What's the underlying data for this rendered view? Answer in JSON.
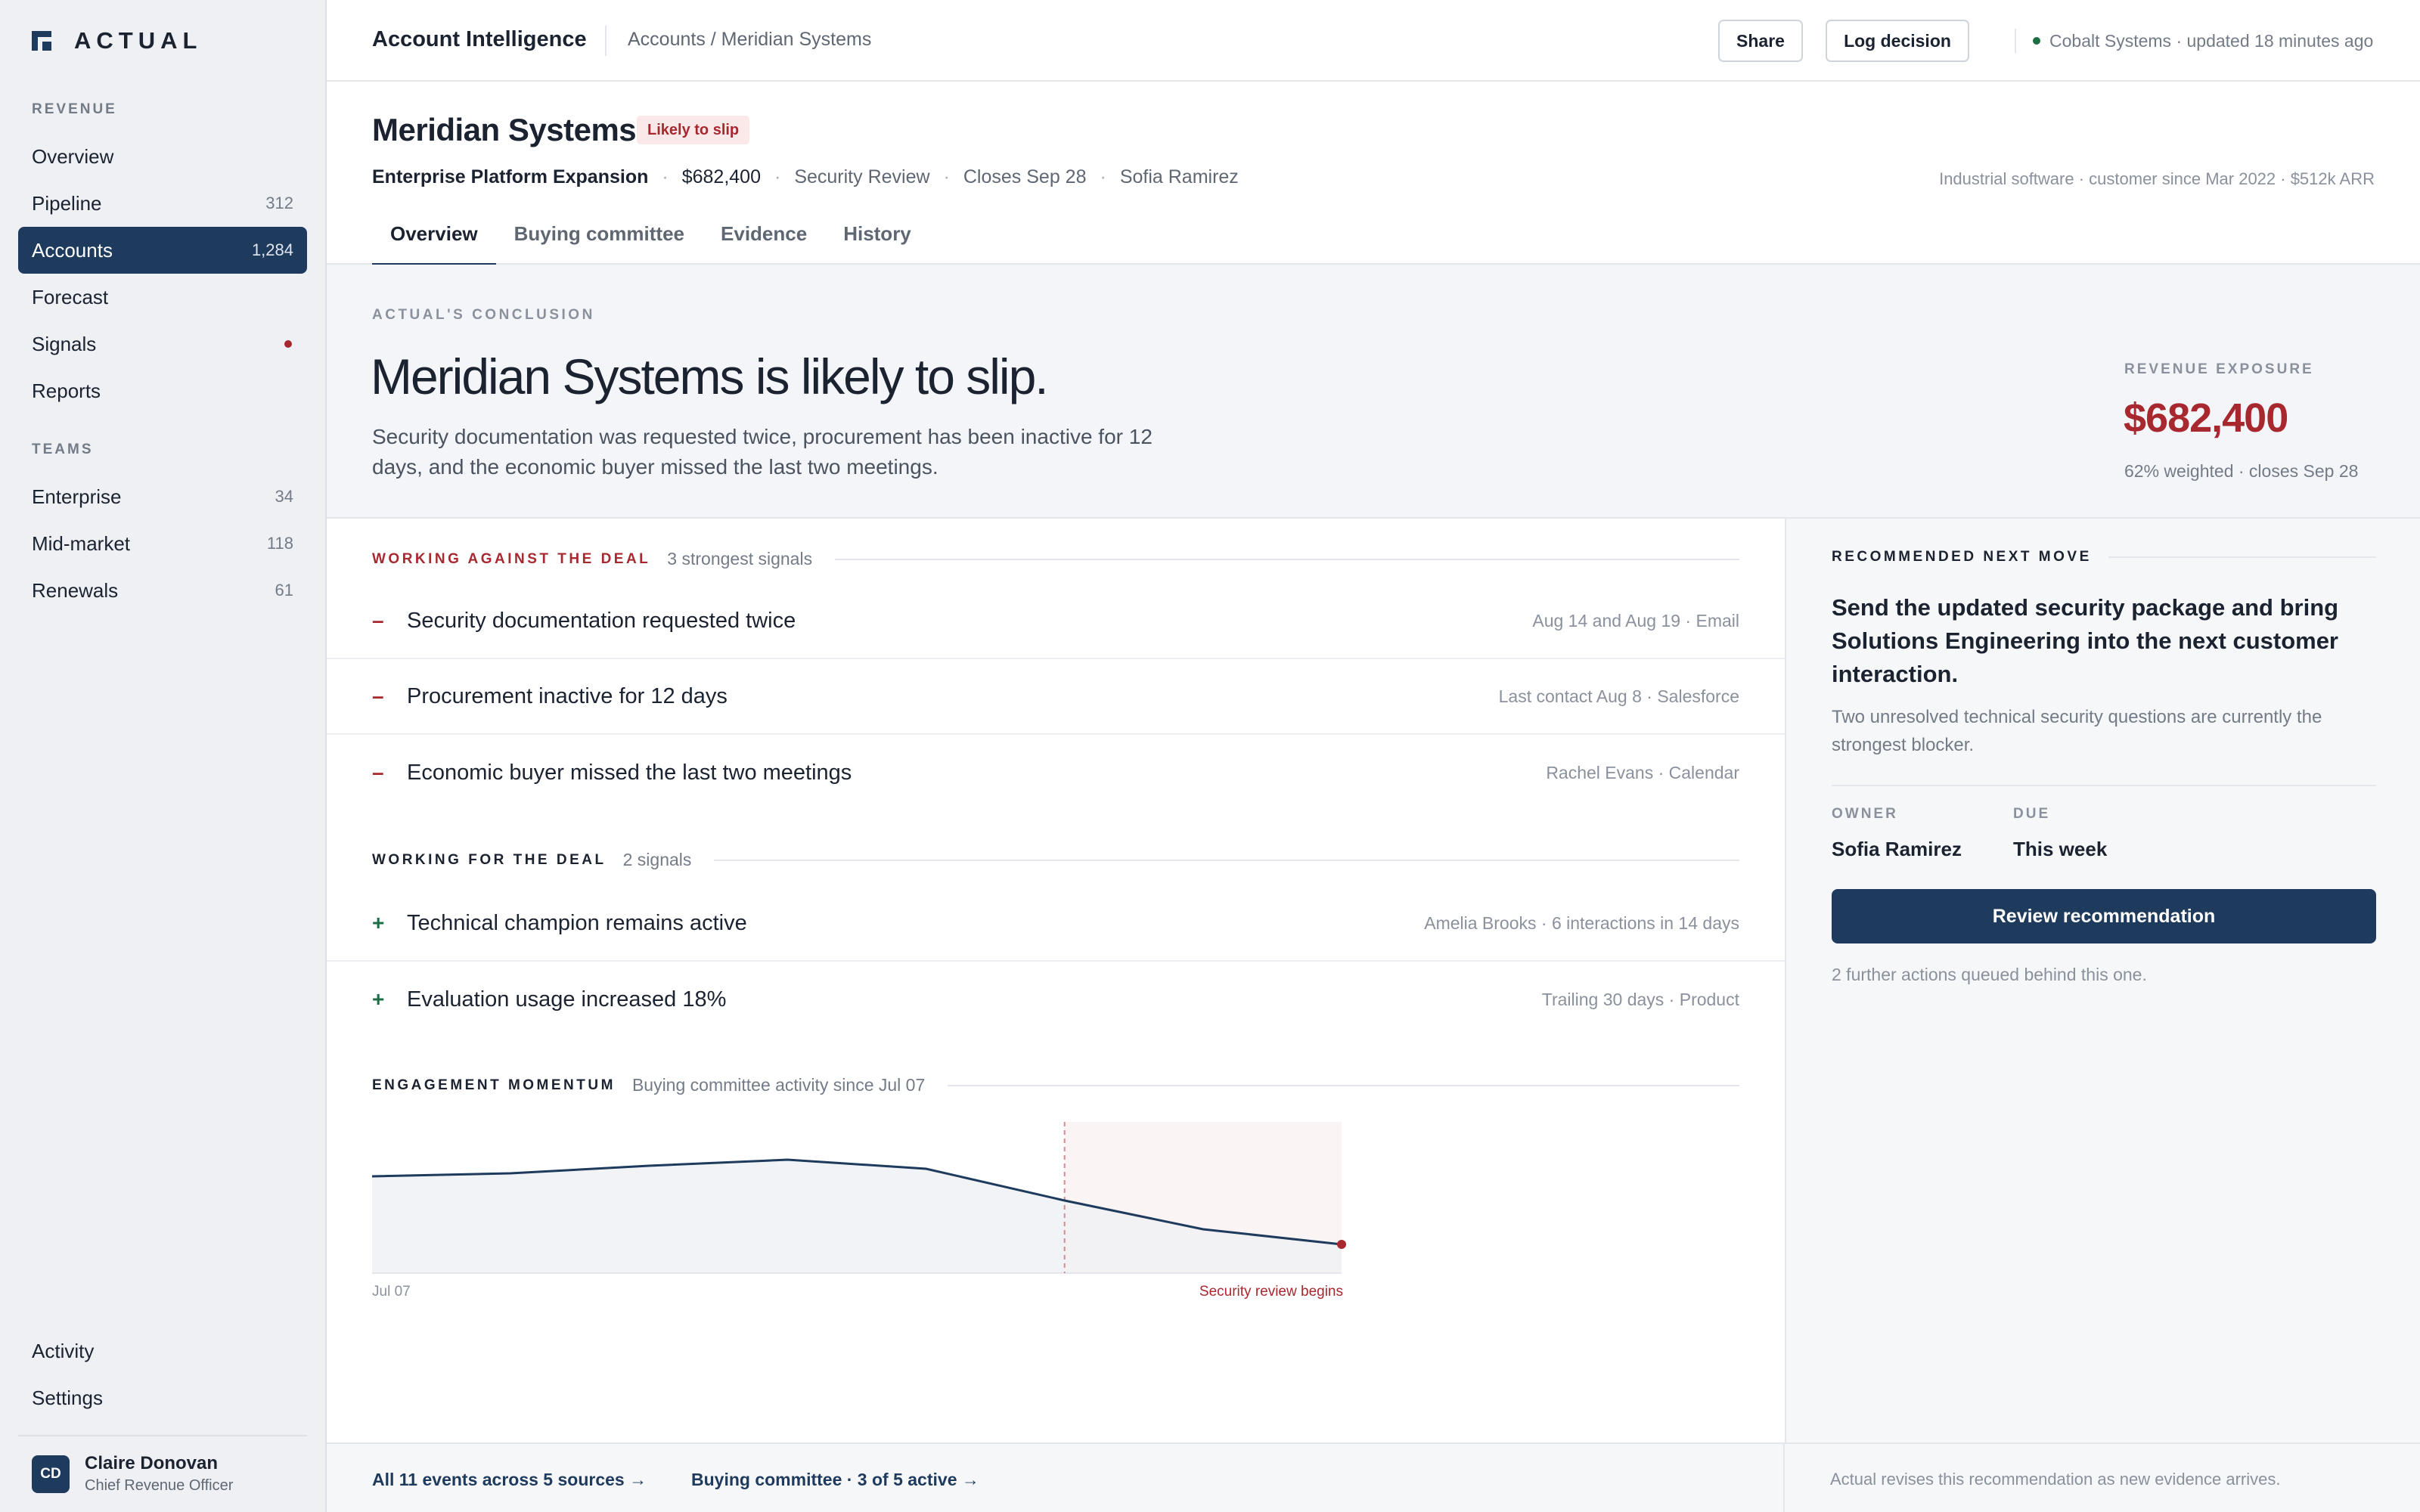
{
  "brand": {
    "name": "ACTUAL"
  },
  "sidebar": {
    "revenue_label": "REVENUE",
    "revenue_items": [
      {
        "label": "Overview",
        "count": ""
      },
      {
        "label": "Pipeline",
        "count": "312"
      },
      {
        "label": "Accounts",
        "count": "1,284",
        "active": true
      },
      {
        "label": "Forecast",
        "count": ""
      },
      {
        "label": "Signals",
        "count": "",
        "alert": true
      },
      {
        "label": "Reports",
        "count": ""
      }
    ],
    "teams_label": "TEAMS",
    "team_items": [
      {
        "label": "Enterprise",
        "count": "34"
      },
      {
        "label": "Mid-market",
        "count": "118"
      },
      {
        "label": "Renewals",
        "count": "61"
      }
    ],
    "bottom_items": [
      {
        "label": "Activity"
      },
      {
        "label": "Settings"
      }
    ],
    "user": {
      "initials": "CD",
      "name": "Claire Donovan",
      "role": "Chief Revenue Officer"
    }
  },
  "topbar": {
    "title": "Account Intelligence",
    "breadcrumb": "Accounts / Meridian Systems",
    "share_label": "Share",
    "log_decision_label": "Log decision",
    "status": "Cobalt Systems · updated 18 minutes ago"
  },
  "account": {
    "name": "Meridian Systems",
    "badge": "Likely to slip",
    "deal_name": "Enterprise Platform Expansion",
    "amount": "$682,400",
    "stage": "Security Review",
    "close": "Closes Sep 28",
    "owner": "Sofia Ramirez",
    "company_info": "Industrial software · customer since Mar 2022 · $512k ARR",
    "tabs": [
      "Overview",
      "Buying committee",
      "Evidence",
      "History"
    ]
  },
  "conclusion": {
    "eyebrow": "ACTUAL'S CONCLUSION",
    "headline": "Meridian Systems is likely to slip.",
    "text": "Security documentation was requested twice, procurement has been inactive for 12 days, and the economic buyer missed the last two meetings.",
    "exposure_label": "REVENUE EXPOSURE",
    "exposure_value": "$682,400",
    "exposure_meta": "62% weighted · closes Sep 28"
  },
  "against": {
    "title": "WORKING AGAINST THE DEAL",
    "subtitle": "3 strongest signals",
    "items": [
      {
        "mark": "–",
        "text": "Security documentation requested twice",
        "source": "Aug 14 and Aug 19 · Email"
      },
      {
        "mark": "–",
        "text": "Procurement inactive for 12 days",
        "source": "Last contact Aug 8 · Salesforce"
      },
      {
        "mark": "–",
        "text": "Economic buyer missed the last two meetings",
        "source": "Rachel Evans · Calendar"
      }
    ]
  },
  "for": {
    "title": "WORKING FOR THE DEAL",
    "subtitle": "2 signals",
    "items": [
      {
        "mark": "+",
        "text": "Technical champion remains active",
        "source": "Amelia Brooks · 6 interactions in 14 days"
      },
      {
        "mark": "+",
        "text": "Evaluation usage increased 18%",
        "source": "Trailing 30 days · Product"
      }
    ]
  },
  "momentum": {
    "title": "ENGAGEMENT MOMENTUM",
    "subtitle": "Buying committee activity since Jul 07"
  },
  "chart_data": {
    "type": "area",
    "x": [
      0,
      1,
      2,
      3,
      4,
      5,
      6,
      7
    ],
    "values": [
      64,
      66,
      71,
      75,
      69,
      48,
      29,
      19
    ],
    "ylim": [
      0,
      100
    ],
    "event_index": 5,
    "x_start_label": "Jul 07",
    "event_label": "Security review begins",
    "colors": {
      "line": "#1e3a5c",
      "area": "#f1f2f5",
      "event_shade": "#faf4f4",
      "event_line": "#d88a8f",
      "end_dot": "#a8282f"
    }
  },
  "recommendation": {
    "eyebrow": "RECOMMENDED NEXT MOVE",
    "title": "Send the updated security package and bring Solutions Engineering into the next customer interaction.",
    "description": "Two unresolved technical security questions are currently the strongest blocker.",
    "owner_label": "OWNER",
    "owner": "Sofia Ramirez",
    "due_label": "DUE",
    "due": "This week",
    "button": "Review recommendation",
    "queued": "2 further actions queued behind this one."
  },
  "footer": {
    "events_link": "All 11 events across 5 sources →",
    "committee_link": "Buying committee · 3 of 5 active →",
    "note": "Actual revises this recommendation as new evidence arrives."
  },
  "colors": {
    "accent": "#1e3a5c",
    "danger": "#a8282f",
    "success": "#1e6e45"
  }
}
